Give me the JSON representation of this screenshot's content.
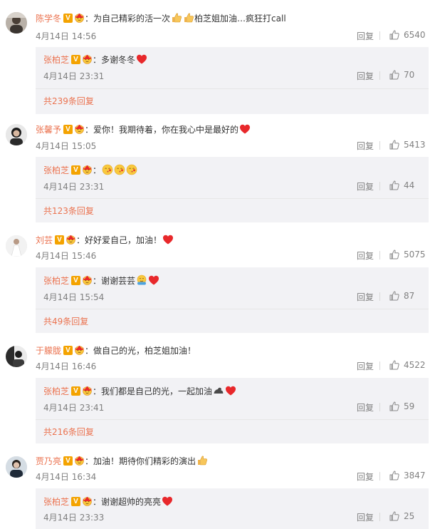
{
  "comments": [
    {
      "user": "陈学冬",
      "text_before": "：为自己精彩的活一次",
      "emojis_mid": [
        "thumbs-up",
        "thumbs-up"
      ],
      "text_after": "柏芝姐加油…疯狂打call",
      "time": "4月14日 14:56",
      "reply_label": "回复",
      "likes": "6540",
      "sub": {
        "user": "张柏芝",
        "text": "：多谢冬冬",
        "time": "4月14日 23:31",
        "reply_label": "回复",
        "likes": "70"
      },
      "more": "共239条回复"
    },
    {
      "user": "张馨予",
      "text": "：爱你！我期待着，你在我心中是最好的",
      "time": "4月14日 15:05",
      "reply_label": "回复",
      "likes": "5413",
      "sub": {
        "user": "张柏芝",
        "text": "：",
        "time": "4月14日 23:31",
        "reply_label": "回复",
        "likes": "44"
      },
      "more": "共123条回复"
    },
    {
      "user": "刘芸",
      "text": "：好好爱自己，加油！",
      "time": "4月14日 15:46",
      "reply_label": "回复",
      "likes": "5075",
      "sub": {
        "user": "张柏芝",
        "text": "：谢谢芸芸",
        "time": "4月14日 15:54",
        "reply_label": "回复",
        "likes": "87"
      },
      "more": "共49条回复"
    },
    {
      "user": "于朦胧",
      "text": "：做自己的光，柏芝姐加油！",
      "time": "4月14日 16:46",
      "reply_label": "回复",
      "likes": "4522",
      "sub": {
        "user": "张柏芝",
        "text": "：我们都是自己的光，一起加油",
        "time": "4月14日 23:41",
        "reply_label": "回复",
        "likes": "59"
      },
      "more": "共216条回复"
    },
    {
      "user": "贾乃亮",
      "text": "：加油！期待你们精彩的演出",
      "time": "4月14日 16:34",
      "reply_label": "回复",
      "likes": "3847",
      "sub": {
        "user": "张柏芝",
        "text": "：谢谢超帅的亮亮",
        "time": "4月14日 23:33",
        "reply_label": "回复",
        "likes": "25"
      }
    }
  ],
  "colors": {
    "username": "#eb7350",
    "text": "#333333",
    "meta": "#808080",
    "sub_bg": "#f2f2f5",
    "verified": "#f4a300",
    "heart": "#e8282b"
  },
  "badges": {
    "verified_letter": "V"
  }
}
